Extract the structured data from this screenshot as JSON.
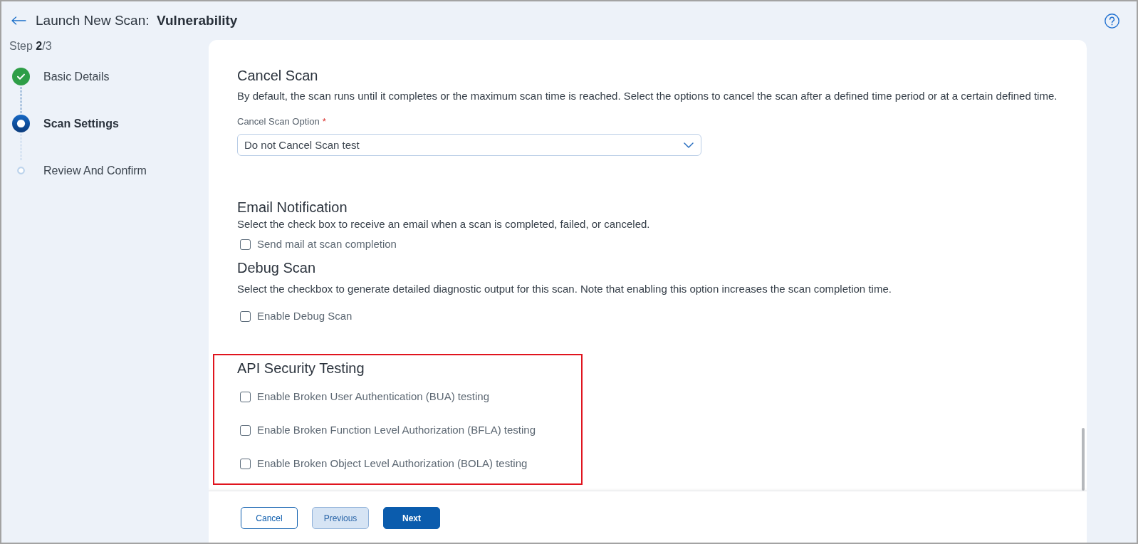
{
  "header": {
    "title": "Launch New Scan:  **Vulnerability**"
  },
  "sidebar": {
    "step_label": "Step **2**/3",
    "steps": [
      {
        "label": "Basic Details",
        "completed": true,
        "selected": false
      },
      {
        "label": "Scan Settings",
        "completed": false,
        "selected": true
      },
      {
        "label": "Review And Confirm",
        "completed": false,
        "selected": false
      }
    ]
  },
  "sections": [
    {
      "heading": "Cancel Scan",
      "description": "By default, the scan runs until it completes or the maximum scan time is reached. Select the options to cancel the scan after a defined time period or at a certain defined time.",
      "field": {
        "label": "Cancel Scan Option",
        "required_mark": "*",
        "value": "Do not Cancel Scan test"
      },
      "highlighted": false
    },
    {
      "heading": "Email Notification",
      "description": "Select the check box to receive an email when a scan is completed, failed, or canceled.",
      "checkboxes": [
        {
          "label": "Send mail at scan completion",
          "checked": false
        }
      ],
      "highlighted": false
    },
    {
      "heading": "Debug Scan",
      "description": "Select the checkbox to generate detailed diagnostic output for this scan. Note that enabling this option increases the scan completion time.",
      "checkboxes": [
        {
          "label": "Enable Debug Scan",
          "checked": false
        }
      ],
      "highlighted": false
    },
    {
      "heading": "API Security Testing",
      "checkboxes": [
        {
          "label": "Enable Broken User Authentication (BUA) testing",
          "checked": false
        },
        {
          "label": "Enable Broken Function Level Authorization (BFLA) testing",
          "checked": false
        },
        {
          "label": "Enable Broken Object Level Authorization (BOLA) testing",
          "checked": false
        }
      ],
      "highlighted": true
    }
  ],
  "footer": {
    "buttons": [
      {
        "label": "Cancel",
        "kind": "outline"
      },
      {
        "label": "Previous",
        "kind": "secondary"
      },
      {
        "label": "Next",
        "kind": "primary"
      }
    ]
  }
}
